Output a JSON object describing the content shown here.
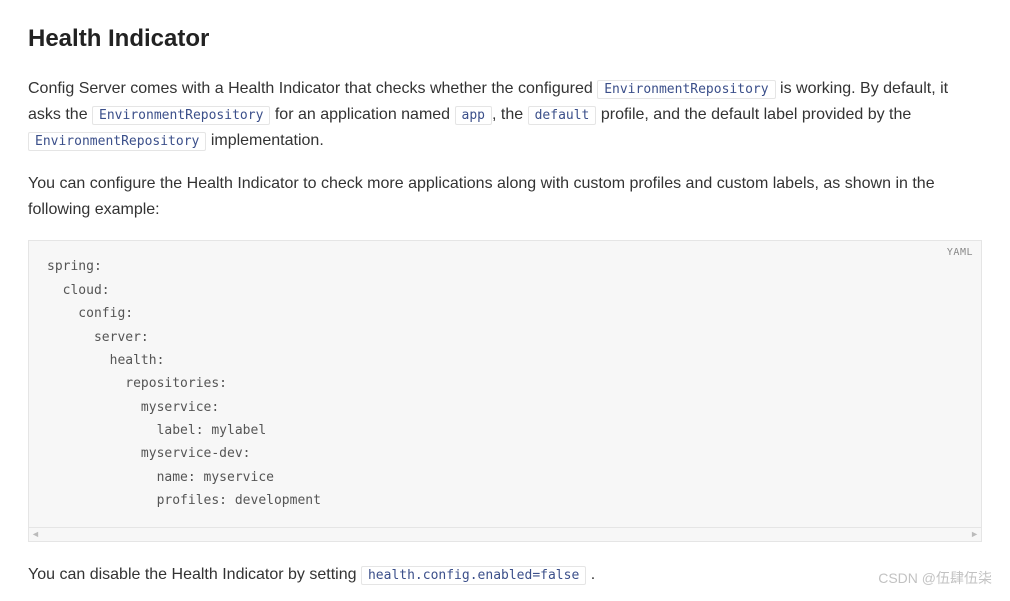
{
  "heading": "Health Indicator",
  "para1": {
    "t1": "Config Server comes with a Health Indicator that checks whether the configured ",
    "c1": "EnvironmentRepository",
    "t2": " is working. By default, it asks the ",
    "c2": "EnvironmentRepository",
    "t3": " for an application named ",
    "c3": "app",
    "t4": ", the ",
    "c4": "default",
    "t5": " profile, and the default label provided by the ",
    "c5": "EnvironmentRepository",
    "t6": " implementation."
  },
  "para2": "You can configure the Health Indicator to check more applications along with custom profiles and custom labels, as shown in the following example:",
  "code": {
    "lang": "YAML",
    "content": "spring:\n  cloud:\n    config:\n      server:\n        health:\n          repositories:\n            myservice:\n              label: mylabel\n            myservice-dev:\n              name: myservice\n              profiles: development"
  },
  "para3": {
    "t1": "You can disable the Health Indicator by setting ",
    "c1": "health.config.enabled=false",
    "t2": " ."
  },
  "watermark": "CSDN @伍肆伍柒"
}
